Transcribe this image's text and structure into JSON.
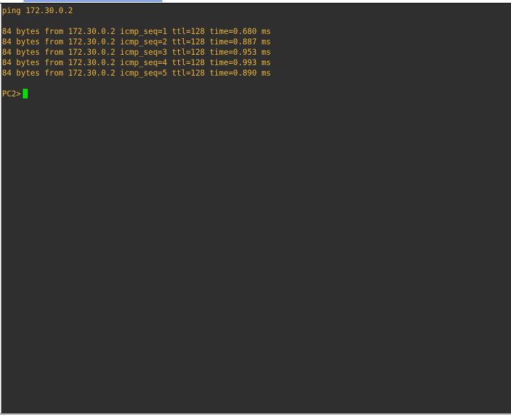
{
  "terminal": {
    "command": "ping 172.30.0.2",
    "output": [
      "84 bytes from 172.30.0.2 icmp_seq=1 ttl=128 time=0.680 ms",
      "84 bytes from 172.30.0.2 icmp_seq=2 ttl=128 time=0.887 ms",
      "84 bytes from 172.30.0.2 icmp_seq=3 ttl=128 time=0.953 ms",
      "84 bytes from 172.30.0.2 icmp_seq=4 ttl=128 time=0.993 ms",
      "84 bytes from 172.30.0.2 icmp_seq=5 ttl=128 time=0.890 ms"
    ],
    "prompt": "PC2>",
    "colors": {
      "background": "#2f2f2f",
      "text": "#f0b534",
      "cursor": "#00e000",
      "tab_indicator": "#8aa6ef"
    }
  }
}
